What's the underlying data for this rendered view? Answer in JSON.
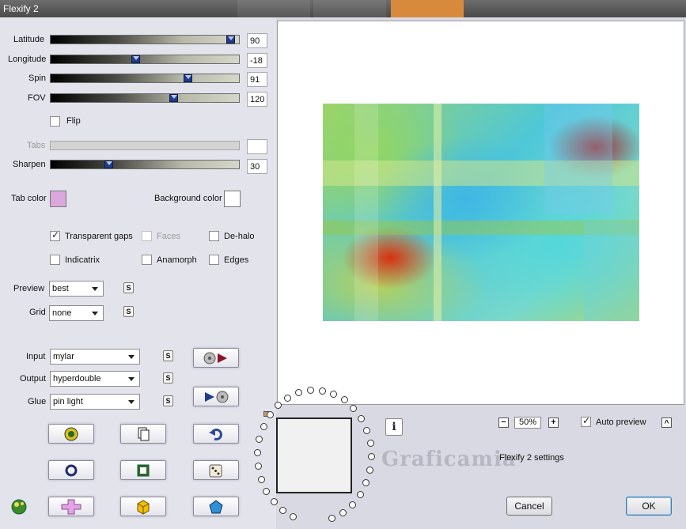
{
  "window": {
    "title": "Flexify 2"
  },
  "sliders": [
    {
      "label": "Latitude",
      "value": "90",
      "fraction": 0.98
    },
    {
      "label": "Longitude",
      "value": "-18",
      "fraction": 0.45
    },
    {
      "label": "Spin",
      "value": "91",
      "fraction": 0.74
    },
    {
      "label": "FOV",
      "value": "120",
      "fraction": 0.66
    }
  ],
  "flip": {
    "label": "Flip",
    "checked": false
  },
  "tabs": {
    "label": "Tabs",
    "value": "",
    "disabled": true
  },
  "sharpen": {
    "label": "Sharpen",
    "value": "30",
    "fraction": 0.3
  },
  "colors": {
    "tab_color_label": "Tab color",
    "tab_color": "#dba8de",
    "background_color_label": "Background color",
    "background_color": "#ffffff"
  },
  "options": {
    "transparent_gaps": {
      "label": "Transparent gaps",
      "checked": true
    },
    "faces": {
      "label": "Faces",
      "checked": false,
      "disabled": true
    },
    "de_halo": {
      "label": "De-halo",
      "checked": false
    },
    "indicatrix": {
      "label": "Indicatrix",
      "checked": false
    },
    "anamorph": {
      "label": "Anamorph",
      "checked": false
    },
    "edges": {
      "label": "Edges",
      "checked": false
    }
  },
  "preview_select": {
    "label": "Preview",
    "value": "best"
  },
  "grid_select": {
    "label": "Grid",
    "value": "none"
  },
  "input_select": {
    "label": "Input",
    "value": "mylar"
  },
  "output_select": {
    "label": "Output",
    "value": "hyperdouble"
  },
  "glue_select": {
    "label": "Glue",
    "value": "pin light"
  },
  "s_label": "S",
  "zoom": {
    "value": "50%",
    "minus": "−",
    "plus": "+"
  },
  "auto_preview": {
    "label": "Auto preview",
    "checked": true
  },
  "collapse_label": "^",
  "settings_label": "Flexify 2 settings",
  "info_label": "i",
  "watermark": "Graficamia",
  "buttons": {
    "cancel": "Cancel",
    "ok": "OK"
  },
  "icons": [
    "load-preset-icon",
    "copy-icon",
    "undo-icon",
    "circle-icon",
    "square-icon",
    "dice-icon",
    "cross-icon",
    "cube-icon",
    "gem-icon",
    "input-play-icon",
    "output-play-icon",
    "logo-icon"
  ]
}
